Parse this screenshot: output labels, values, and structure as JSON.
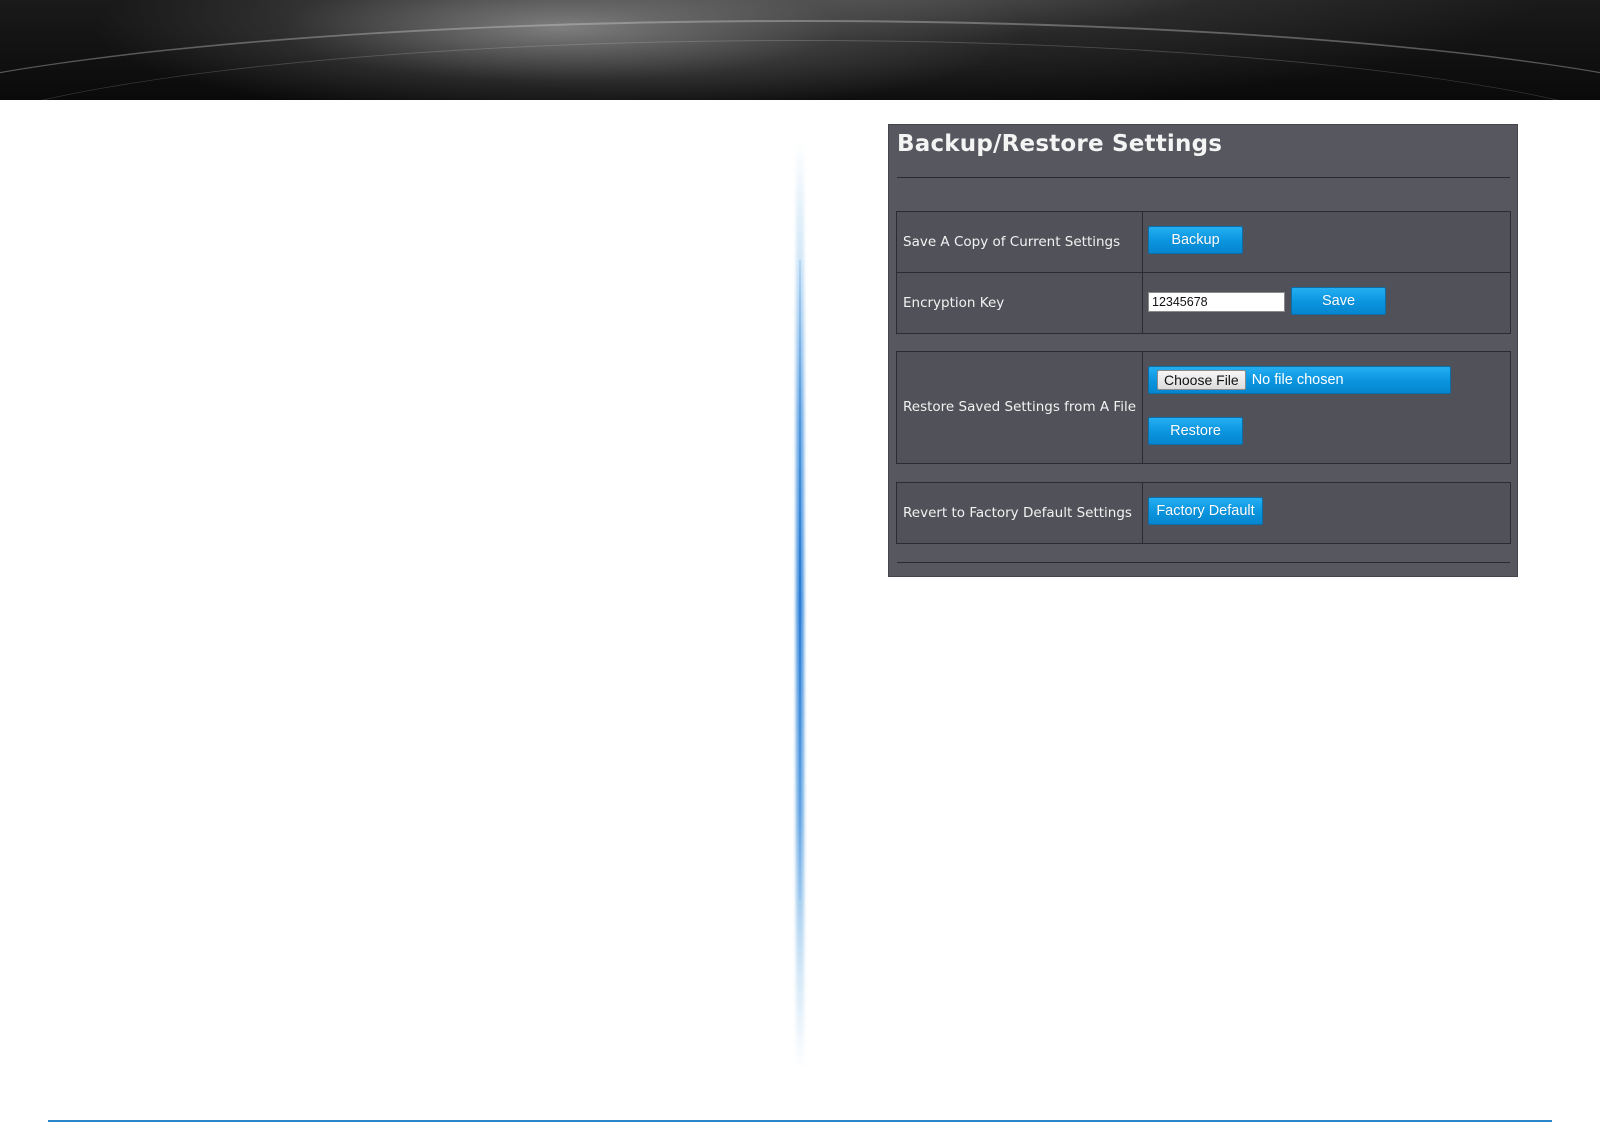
{
  "panel": {
    "title": "Backup/Restore Settings"
  },
  "backup_section": {
    "save_copy": {
      "label": "Save A Copy of Current Settings",
      "button_label": "Backup"
    },
    "encryption": {
      "label": "Encryption Key",
      "value": "12345678",
      "button_label": "Save"
    }
  },
  "restore_section": {
    "label": "Restore Saved Settings from A File",
    "file_button_label": "Choose File",
    "file_status": "No file chosen",
    "button_label": "Restore"
  },
  "factory_section": {
    "label": "Revert to Factory Default Settings",
    "button_label": "Factory Default"
  },
  "colors": {
    "panel_bg": "#56575f",
    "button_blue": "#0a94de",
    "divider_blue": "#2a86c8"
  }
}
